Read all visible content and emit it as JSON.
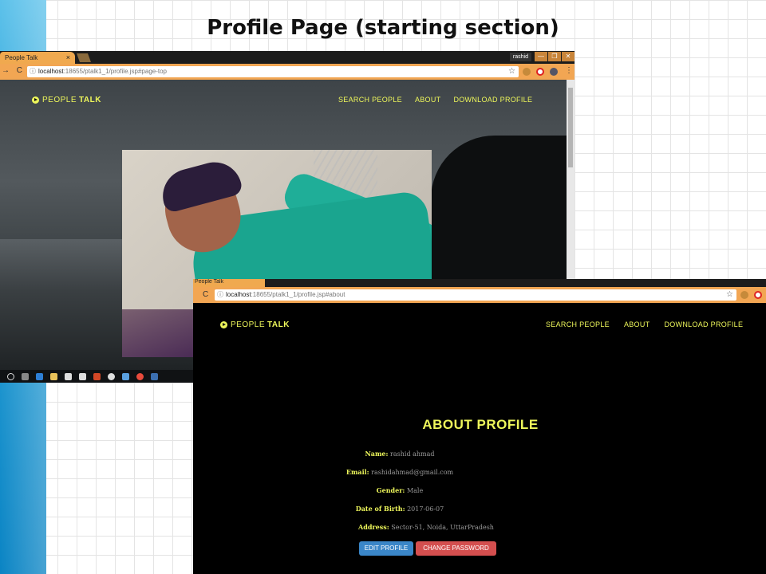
{
  "slide": {
    "title": "Profile Page (starting section)"
  },
  "window1": {
    "tab_title": "People Talk",
    "tab_close": "×",
    "user_chip": "rashid",
    "window_buttons": [
      "—",
      "❐",
      "✕"
    ],
    "url_host": "localhost",
    "url_path": ":18655/ptalk1_1/profile.jsp#page-top",
    "nav_back": "→",
    "nav_reload": "C",
    "star": "☆",
    "logo_light": "PEOPLE",
    "logo_bold": "TALK",
    "menu": [
      "SEARCH PEOPLE",
      "ABOUT",
      "DOWNLOAD PROFILE"
    ]
  },
  "window2": {
    "tab_title": "People Talk",
    "url_host": "localhost",
    "url_path": ":18655/ptalk1_1/profile.jsp#about",
    "nav_reload": "C",
    "star": "☆",
    "logo_light": "PEOPLE",
    "logo_bold": "TALK",
    "menu": [
      "SEARCH PEOPLE",
      "ABOUT",
      "DOWNLOAD PROFILE"
    ],
    "about_title": "ABOUT PROFILE",
    "fields": [
      {
        "label": "Name:",
        "value": "rashid ahmad"
      },
      {
        "label": "Email:",
        "value": "rashidahmad@gmail.com"
      },
      {
        "label": "Gender:",
        "value": "Male"
      },
      {
        "label": "Date of Birth:",
        "value": "2017-06-07"
      },
      {
        "label": "Address:",
        "value": "Sector-51, Noida, UttarPradesh"
      }
    ],
    "edit_button": "EDIT PROFILE",
    "password_button": "CHANGE PASSWORD"
  },
  "colors": {
    "accent_yellow": "#eef75b",
    "browser_orange": "#f2a653",
    "edit_blue": "#3a86c8",
    "password_red": "#d44f4f"
  },
  "taskbar_icons": [
    "start-circle-icon",
    "task-view-icon",
    "edge-icon",
    "file-explorer-icon",
    "store-icon",
    "mail-icon",
    "powerpoint-icon",
    "media-icon",
    "app-icon",
    "chrome-icon",
    "app2-icon"
  ]
}
